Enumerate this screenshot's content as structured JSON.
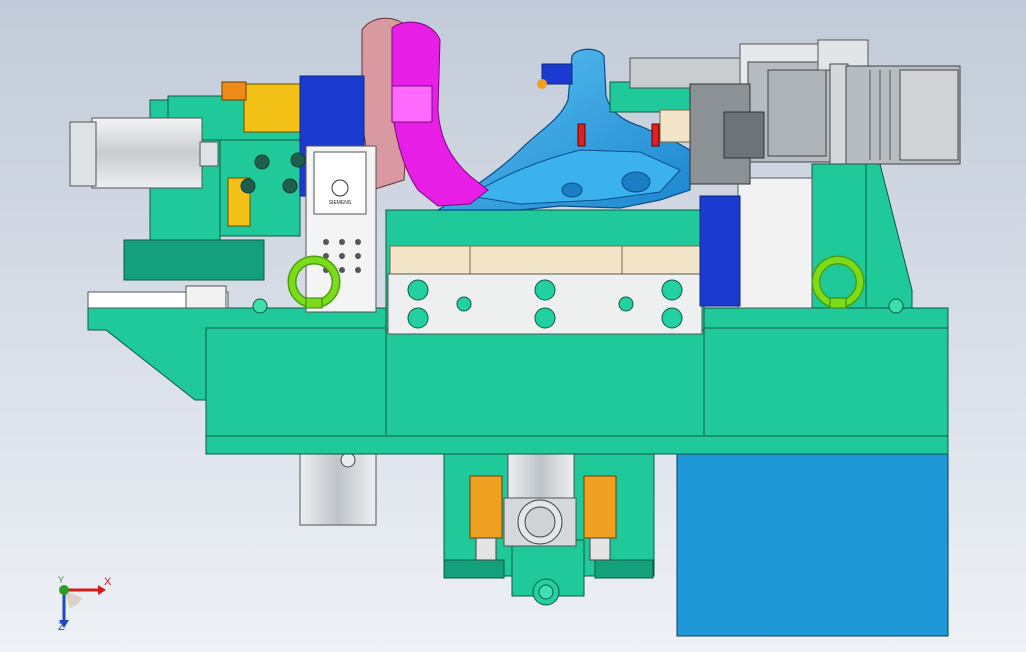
{
  "viewport": {
    "background_top": "#c2cbd9",
    "background_bottom": "#eef1f6"
  },
  "colors": {
    "fixture_green": "#1fc99a",
    "fixture_green_dark": "#14a07a",
    "casting_blue": "#27a6e8",
    "bracket_magenta": "#e61ee6",
    "bracket_pink": "#d89aa0",
    "cylinder_silver": "#d6d9dc",
    "motor_gray": "#b7bcc0",
    "clamp_orange": "#f0a020",
    "block_yellow": "#f3c018",
    "base_blue": "#1e98d6",
    "eye_bolt": "#7ddc1a",
    "pad_cream": "#f3e6c8",
    "pin_red": "#e02020",
    "bolt_teal": "#22d0a0"
  },
  "parts": {
    "nameplate_text": "SIEMENS"
  },
  "triad": {
    "x_label": "X",
    "y_label": "Y",
    "z_label": "Z",
    "x_color": "#d21c1c",
    "y_color": "#2a9d2a",
    "z_color": "#2246c8"
  }
}
